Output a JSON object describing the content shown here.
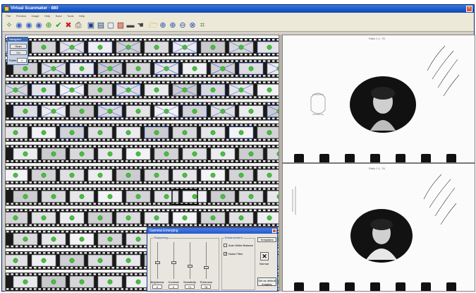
{
  "window": {
    "title": "Virtual Scanmaker - 880"
  },
  "menu": {
    "items": [
      "File",
      "Preview",
      "Image",
      "Help",
      "Scan",
      "Tools",
      "Help"
    ]
  },
  "toolbar": {
    "buttons": [
      {
        "icon": "scanner-icon",
        "glyph": "✧"
      },
      {
        "icon": "disk-blue-icon",
        "glyph": "◉"
      },
      {
        "icon": "disk-blue-icon",
        "glyph": "◉"
      },
      {
        "icon": "disk-blue-icon",
        "glyph": "◉"
      },
      {
        "icon": "add-green-icon",
        "glyph": "⊕"
      },
      {
        "icon": "check-icon",
        "glyph": "✔"
      },
      {
        "icon": "cross-icon",
        "glyph": "✖"
      },
      {
        "icon": "print-icon",
        "glyph": "⎙"
      },
      {
        "icon": "save-icon",
        "glyph": "▣"
      },
      {
        "icon": "save-as-icon",
        "glyph": "▤"
      },
      {
        "icon": "frame-icon",
        "glyph": "▢"
      },
      {
        "icon": "crop-icon",
        "glyph": "▨"
      },
      {
        "icon": "bar-icon",
        "glyph": "▬"
      },
      {
        "icon": "hand-icon",
        "glyph": "☚"
      },
      {
        "icon": "folder-icon",
        "glyph": "🗁"
      },
      {
        "icon": "zoom-in-icon",
        "glyph": "⊕"
      },
      {
        "icon": "zoom-fit-icon",
        "glyph": "⊕"
      },
      {
        "icon": "zoom-out-icon",
        "glyph": "⊖"
      },
      {
        "icon": "zoom-all-icon",
        "glyph": "⊗"
      },
      {
        "icon": "grid-icon",
        "glyph": "⌗"
      }
    ]
  },
  "navigator": {
    "title": "Navigator",
    "scan_label": "Scan",
    "go_label": "Go",
    "field_label": "Roller",
    "field_value": "1"
  },
  "dialog": {
    "title": "Gamma Emerging",
    "group_left": "Sharpening",
    "group_right": "Enhancement",
    "sliders": [
      {
        "name": "Brightness",
        "value": "0",
        "level": 0.45
      },
      {
        "name": "Contrast",
        "value": "0",
        "level": 0.45
      },
      {
        "name": "Sensitivity",
        "value": "71",
        "level": 0.35
      },
      {
        "name": "Thickness",
        "value": "78",
        "level": 0.3
      }
    ],
    "checkboxes": [
      {
        "label": "Auto White Balance",
        "checked": false
      },
      {
        "label": "Noise Filter",
        "checked": true
      }
    ],
    "templates_label": "Templates",
    "normal_label": "Normal",
    "default_label": "Set as default imaging"
  },
  "preview": {
    "top_label": "Ratio 1:1, 76",
    "bottom_label": "Ratio 1:1, 76"
  }
}
